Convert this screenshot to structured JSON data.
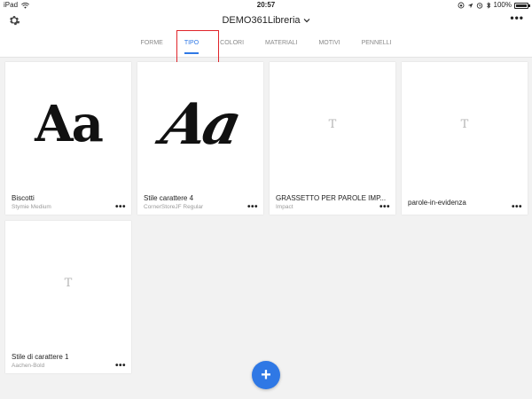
{
  "status_bar": {
    "device": "iPad",
    "time": "20:57",
    "battery": "100%"
  },
  "header": {
    "library_title": "DEMO361Libreria",
    "tabs": [
      {
        "label": "FORME",
        "active": false
      },
      {
        "label": "TIPO",
        "active": true
      },
      {
        "label": "COLORI",
        "active": false
      },
      {
        "label": "MATERIALI",
        "active": false
      },
      {
        "label": "MOTIVI",
        "active": false
      },
      {
        "label": "PENNELLI",
        "active": false
      }
    ]
  },
  "cards": [
    {
      "preview": "Aa",
      "name": "Biscotti",
      "font": "Stymie Medium"
    },
    {
      "preview": "Aa",
      "name": "Stile carattere 4",
      "font": "CornerStoreJF Regular"
    },
    {
      "preview": "T",
      "name": "GRASSETTO PER PAROLE IMP...",
      "font": "Impact"
    },
    {
      "preview": "T",
      "name": "parole-in-evidenza",
      "font": ""
    },
    {
      "preview": "T",
      "name": "Stile di carattere 1",
      "font": "Aachen-Bold"
    }
  ],
  "more_label": "•••",
  "fab_label": "+",
  "colors": {
    "accent": "#2f78e5",
    "highlight": "#e0242a"
  }
}
